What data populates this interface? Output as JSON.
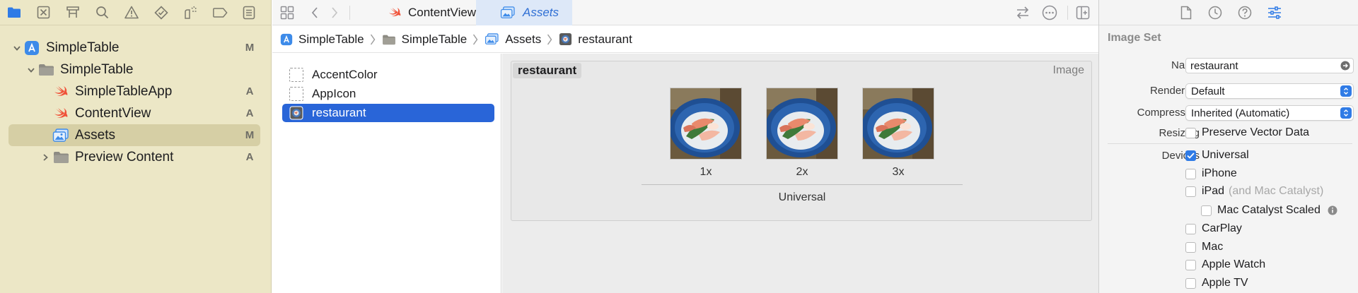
{
  "navigator": {
    "toolbar_icons": [
      "folder-icon",
      "source-control-icon",
      "symbol-icon",
      "find-icon",
      "issue-icon",
      "test-icon",
      "debug-icon",
      "breakpoint-icon",
      "report-icon"
    ],
    "tree": [
      {
        "label": "SimpleTable",
        "badge": "M",
        "icon": "app-project-icon",
        "level": 0,
        "expanded": true
      },
      {
        "label": "SimpleTable",
        "badge": "",
        "icon": "folder-icon",
        "level": 1,
        "expanded": true
      },
      {
        "label": "SimpleTableApp",
        "badge": "A",
        "icon": "swift-file-icon",
        "level": 2
      },
      {
        "label": "ContentView",
        "badge": "A",
        "icon": "swift-file-icon",
        "level": 2
      },
      {
        "label": "Assets",
        "badge": "M",
        "icon": "asset-catalog-icon",
        "level": 2,
        "selected": true
      },
      {
        "label": "Preview Content",
        "badge": "A",
        "icon": "folder-icon",
        "level": 2,
        "expanded": false
      }
    ]
  },
  "tabs": {
    "content_view": "ContentView",
    "assets": "Assets"
  },
  "jumpbar": {
    "items": [
      "SimpleTable",
      "SimpleTable",
      "Assets",
      "restaurant"
    ]
  },
  "asset_list": {
    "items": [
      {
        "label": "AccentColor",
        "icon": "color-set-icon"
      },
      {
        "label": "AppIcon",
        "icon": "app-icon-set-icon"
      },
      {
        "label": "restaurant",
        "icon": "image-set-icon",
        "selected": true
      }
    ]
  },
  "asset_detail": {
    "set_name": "restaurant",
    "set_type": "Image",
    "slots": [
      "1x",
      "2x",
      "3x"
    ],
    "device_label": "Universal"
  },
  "inspector": {
    "section_title": "Image Set",
    "name_label": "Name",
    "name_value": "restaurant",
    "render_as_label": "Render As",
    "render_as_value": "Default",
    "compression_label": "Compression",
    "compression_value": "Inherited (Automatic)",
    "resizing_label": "Resizing",
    "preserve_vector": "Preserve Vector Data",
    "devices_label": "Devices",
    "devices": {
      "universal": "Universal",
      "iphone": "iPhone",
      "ipad": "iPad",
      "ipad_note": "(and Mac Catalyst)",
      "mac_catalyst_scaled": "Mac Catalyst Scaled",
      "carplay": "CarPlay",
      "mac": "Mac",
      "apple_watch": "Apple Watch",
      "apple_tv": "Apple TV"
    }
  },
  "colors": {
    "accent": "#2f7be6",
    "navigator_bg": "#ece7c6",
    "selection": "#2965d8"
  }
}
